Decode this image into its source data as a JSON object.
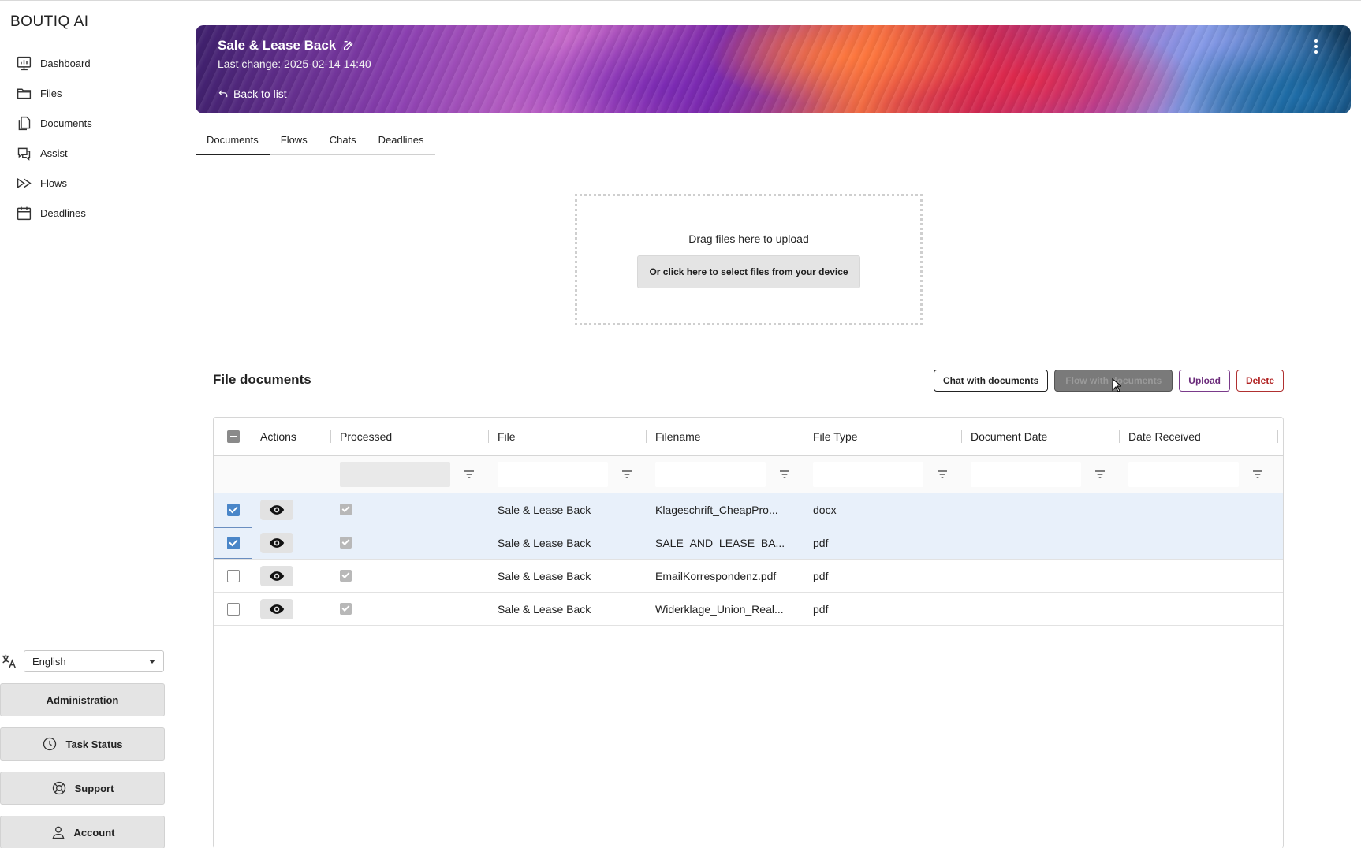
{
  "app": {
    "logo": "BOUTIQ AI"
  },
  "sidebar": {
    "items": [
      {
        "label": "Dashboard",
        "icon": "chart-icon"
      },
      {
        "label": "Files",
        "icon": "folder-icon"
      },
      {
        "label": "Documents",
        "icon": "documents-icon"
      },
      {
        "label": "Assist",
        "icon": "chat-icon"
      },
      {
        "label": "Flows",
        "icon": "flows-icon"
      },
      {
        "label": "Deadlines",
        "icon": "calendar-icon"
      }
    ],
    "language": "English",
    "admin_label": "Administration",
    "task_status_label": "Task Status",
    "support_label": "Support",
    "account_label": "Account"
  },
  "banner": {
    "title": "Sale & Lease Back",
    "last_change": "Last change: 2025-02-14 14:40",
    "back_label": "Back to list"
  },
  "tabs": [
    {
      "label": "Documents",
      "active": true
    },
    {
      "label": "Flows",
      "active": false
    },
    {
      "label": "Chats",
      "active": false
    },
    {
      "label": "Deadlines",
      "active": false
    }
  ],
  "upload": {
    "drag_text": "Drag files here to upload",
    "select_label": "Or click here to select files from your device"
  },
  "documents": {
    "title": "File documents",
    "buttons": {
      "chat": "Chat with documents",
      "flow": "Flow with documents",
      "upload": "Upload",
      "delete": "Delete"
    },
    "columns": [
      "Actions",
      "Processed",
      "File",
      "Filename",
      "File Type",
      "Document Date",
      "Date Received"
    ],
    "rows": [
      {
        "selected": true,
        "processed": true,
        "file": "Sale & Lease Back",
        "filename": "Klageschrift_CheapPro...",
        "type": "docx",
        "doc_date": "",
        "received": ""
      },
      {
        "selected": true,
        "processed": true,
        "file": "Sale & Lease Back",
        "filename": "SALE_AND_LEASE_BA...",
        "type": "pdf",
        "doc_date": "",
        "received": ""
      },
      {
        "selected": false,
        "processed": true,
        "file": "Sale & Lease Back",
        "filename": "EmailKorrespondenz.pdf",
        "type": "pdf",
        "doc_date": "",
        "received": ""
      },
      {
        "selected": false,
        "processed": true,
        "file": "Sale & Lease Back",
        "filename": "Widerklage_Union_Real...",
        "type": "pdf",
        "doc_date": "",
        "received": ""
      }
    ]
  }
}
